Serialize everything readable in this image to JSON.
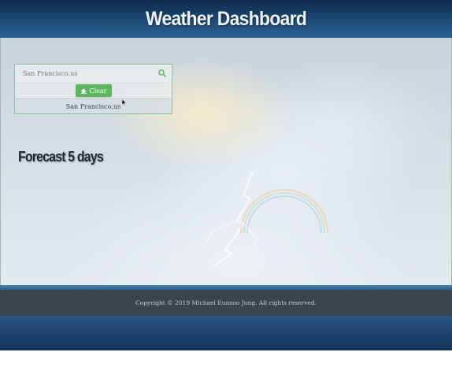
{
  "header": {
    "title": "Weather Dashboard"
  },
  "search": {
    "value": "San Francisco,us",
    "search_icon": "search-icon",
    "clear_label": "Clear",
    "clear_icon": "eraser-icon",
    "history": [
      "San Francisco,us"
    ]
  },
  "forecast": {
    "title": "Forecast 5 days"
  },
  "footer": {
    "copyright": "Copyright © 2019 Michael Eunsoo Jung. All rights reserved."
  },
  "colors": {
    "header_bg": "#1d4b78",
    "clear_button": "#5cb85c",
    "footer_bg": "#3a4449",
    "panel_border": "#8fc29a"
  }
}
